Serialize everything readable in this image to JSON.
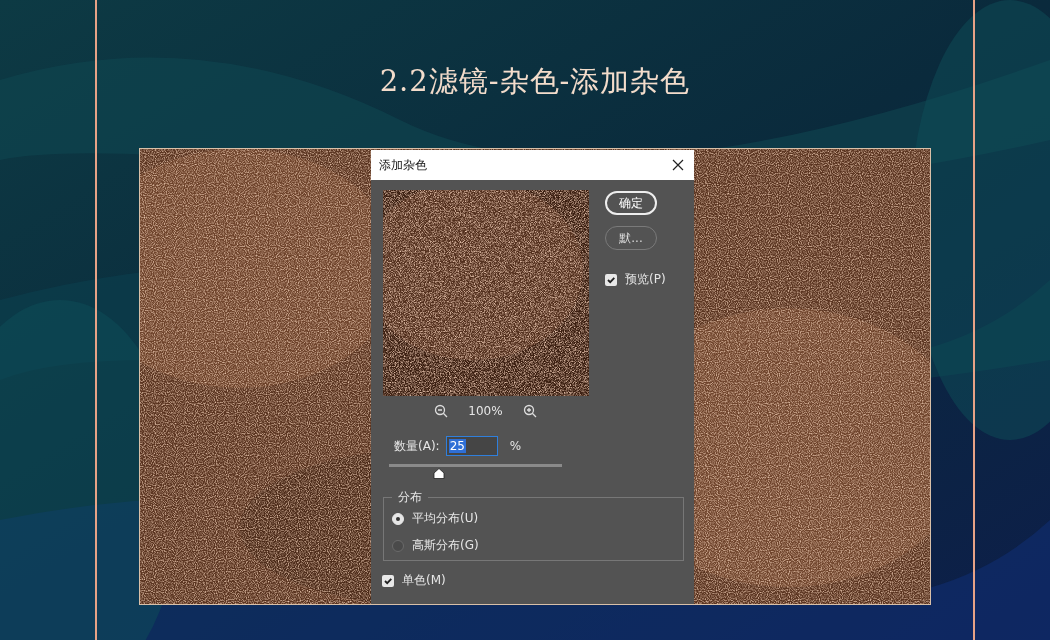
{
  "page": {
    "title": "2.2滤镜-杂色-添加杂色"
  },
  "dialog": {
    "title": "添加杂色",
    "buttons": [
      {
        "label": "确定",
        "kind": "default"
      },
      {
        "label": "默...",
        "kind": "secondary"
      }
    ],
    "preview": {
      "label": "预览(P)",
      "checked": true
    },
    "zoom": "100%",
    "amount": {
      "label": "数量(A):",
      "value": "25",
      "unit": "%",
      "level": 0.29
    },
    "distribution": {
      "legend": "分布",
      "options": [
        {
          "label": "平均分布(U)",
          "selected": true
        },
        {
          "label": "高斯分布(G)",
          "selected": false
        }
      ]
    },
    "monochrome": {
      "label": "单色(M)",
      "checked": true
    }
  }
}
